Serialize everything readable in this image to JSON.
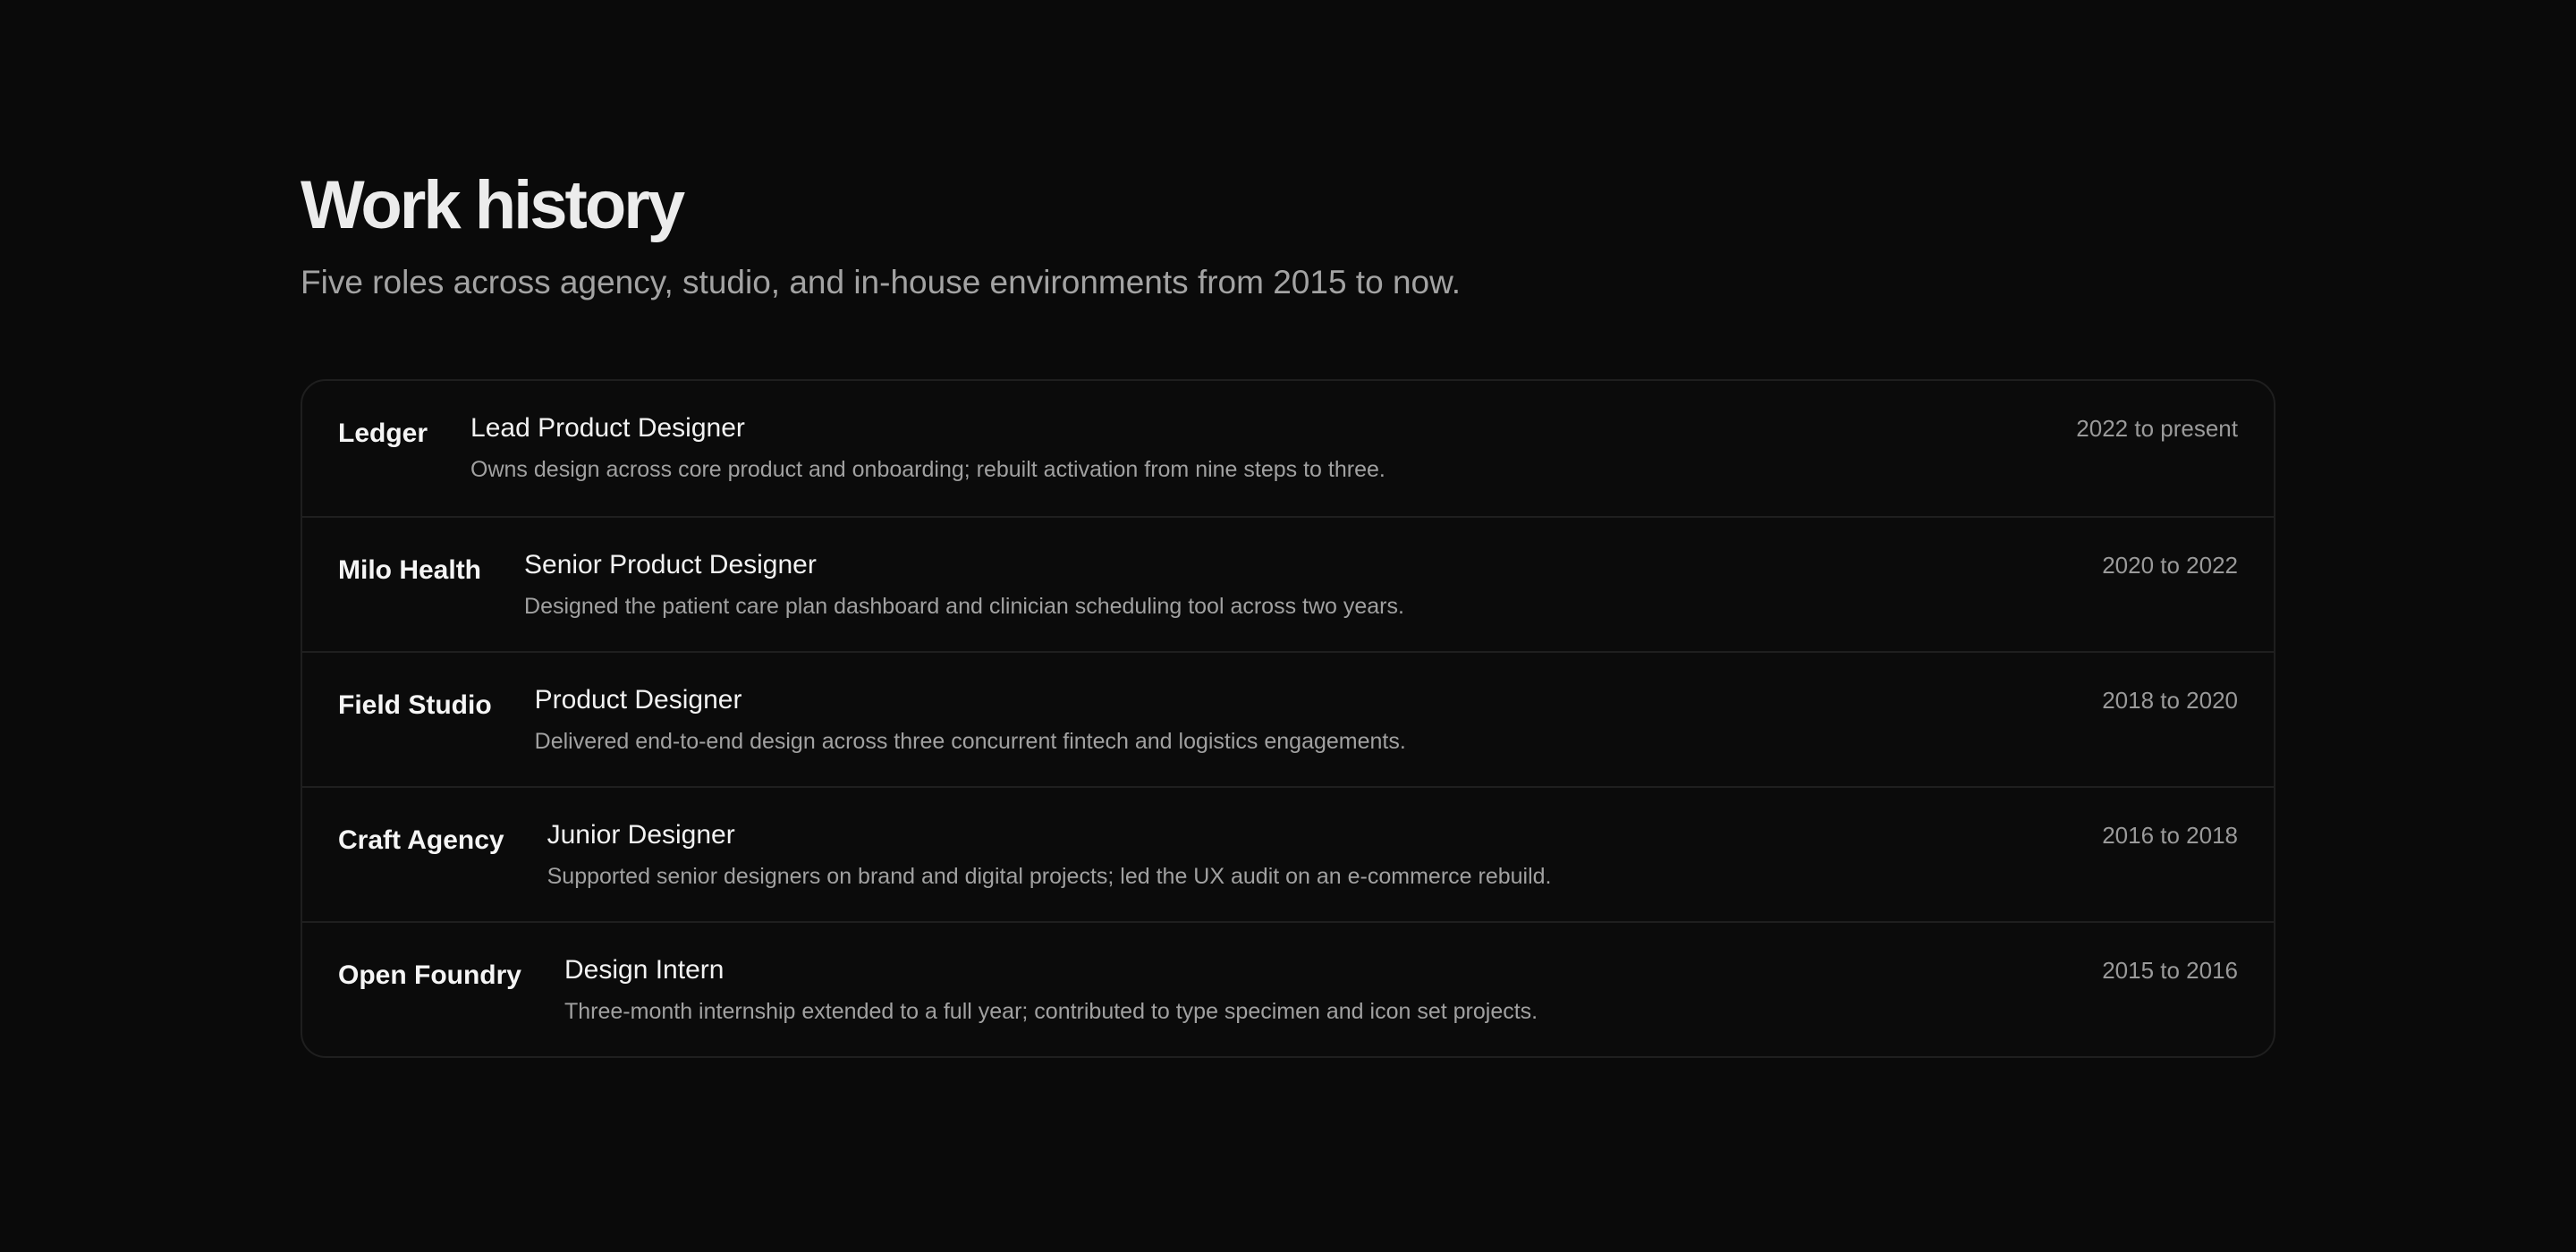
{
  "header": {
    "title": "Work history",
    "subtitle": "Five roles across agency, studio, and in-house environments from 2015 to now."
  },
  "roles": [
    {
      "company": "Ledger",
      "title": "Lead Product Designer",
      "description": "Owns design across core product and onboarding; rebuilt activation from nine steps to three.",
      "dates": "2022 to present"
    },
    {
      "company": "Milo Health",
      "title": "Senior Product Designer",
      "description": "Designed the patient care plan dashboard and clinician scheduling tool across two years.",
      "dates": "2020 to 2022"
    },
    {
      "company": "Field Studio",
      "title": "Product Designer",
      "description": "Delivered end-to-end design across three concurrent fintech and logistics engagements.",
      "dates": "2018 to 2020"
    },
    {
      "company": "Craft Agency",
      "title": "Junior Designer",
      "description": "Supported senior designers on brand and digital projects; led the UX audit on an e-commerce rebuild.",
      "dates": "2016 to 2018"
    },
    {
      "company": "Open Foundry",
      "title": "Design Intern",
      "description": "Three-month internship extended to a full year; contributed to type specimen and icon set projects.",
      "dates": "2015 to 2016"
    }
  ],
  "colors": {
    "background": "#0a0a0a",
    "border": "#1f1f1f",
    "text_primary": "#ededed",
    "text_secondary": "#a3a3a3"
  }
}
